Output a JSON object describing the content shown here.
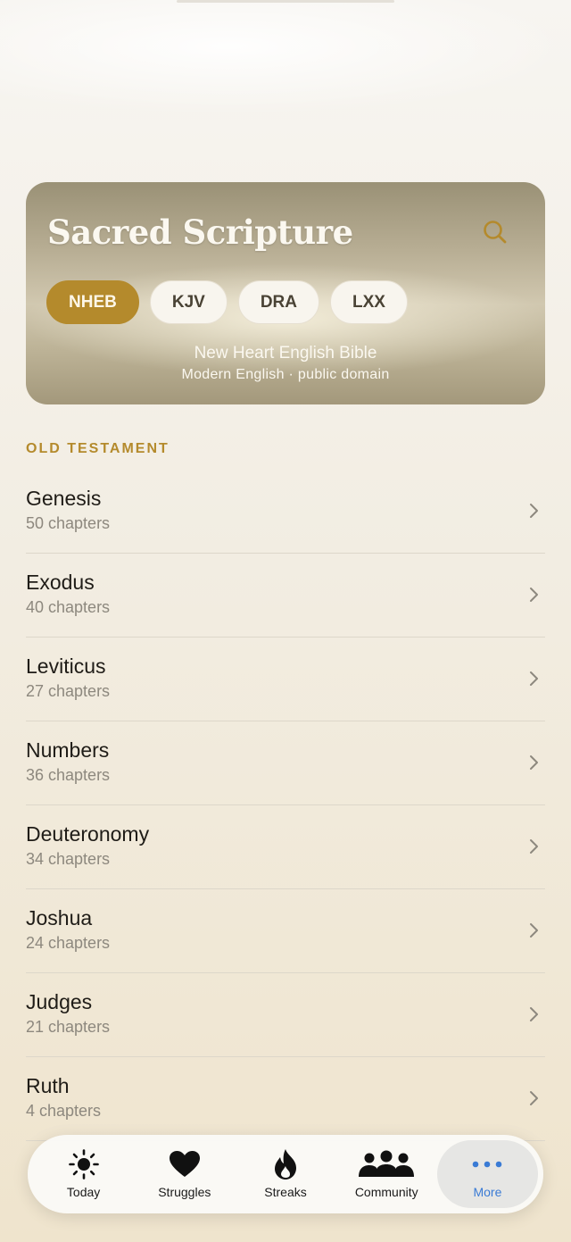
{
  "hero": {
    "title": "Sacred Scripture",
    "versions": [
      {
        "label": "NHEB",
        "active": true
      },
      {
        "label": "KJV",
        "active": false
      },
      {
        "label": "DRA",
        "active": false
      },
      {
        "label": "LXX",
        "active": false
      }
    ],
    "selected_version_name": "New Heart English Bible",
    "selected_version_desc": "Modern English · public domain",
    "search_icon": "search-icon"
  },
  "section": {
    "label": "OLD TESTAMENT"
  },
  "books": [
    {
      "name": "Genesis",
      "chapters": "50 chapters"
    },
    {
      "name": "Exodus",
      "chapters": "40 chapters"
    },
    {
      "name": "Leviticus",
      "chapters": "27 chapters"
    },
    {
      "name": "Numbers",
      "chapters": "36 chapters"
    },
    {
      "name": "Deuteronomy",
      "chapters": "34 chapters"
    },
    {
      "name": "Joshua",
      "chapters": "24 chapters"
    },
    {
      "name": "Judges",
      "chapters": "21 chapters"
    },
    {
      "name": "Ruth",
      "chapters": "4 chapters"
    }
  ],
  "tabbar": {
    "tabs": [
      {
        "label": "Today",
        "icon": "sun-icon"
      },
      {
        "label": "Struggles",
        "icon": "heart-icon"
      },
      {
        "label": "Streaks",
        "icon": "flame-icon"
      },
      {
        "label": "Community",
        "icon": "people-icon"
      },
      {
        "label": "More",
        "icon": "more-icon",
        "active": true
      }
    ]
  },
  "colors": {
    "accent": "#b48a2c",
    "active_tab": "#3a7bd5"
  }
}
